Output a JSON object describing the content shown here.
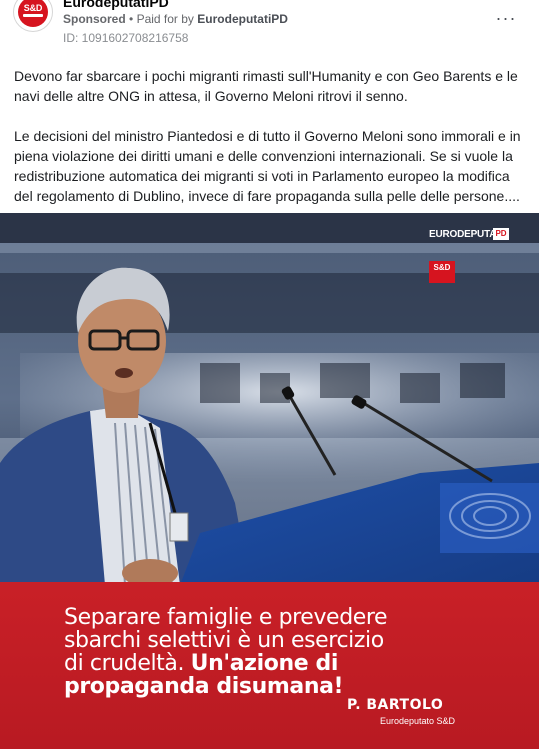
{
  "post": {
    "page_name": "EurodeputatiPD",
    "avatar_text": "S&D",
    "sponsored_label": "Sponsored",
    "separator": "•",
    "paid_for_prefix": "Paid for by",
    "paid_for_by": "EurodeputatiPD",
    "ad_id": "ID: 1091602708216758",
    "more_icon": "more-dots-icon",
    "more_label": "···",
    "paragraphs": [
      "Devono far sbarcare i pochi migranti rimasti sull'Humanity e con Geo Barents e le navi delle altre ONG in attesa, il Governo Meloni ritrovi il senno.",
      "Le decisioni del ministro Piantedosi e di tutto il Governo Meloni sono immorali e in piena violazione dei diritti umani e delle convenzioni internazionali. Se si vuole la redistribuzione automatica dei migranti si voti in Parlamento europeo la modifica del regolamento di Dublino, invece di fare propaganda sulla pelle delle persone...."
    ]
  },
  "creative": {
    "logo_euro": "EURODEPUTATI",
    "logo_pd": "PD",
    "logo_sd": "S&D",
    "banner_lines": [
      "Separare famiglie e prevedere",
      "sbarchi selettivi è un esercizio",
      "di crudeltà.",
      "Un'azione di",
      "propaganda disumana!"
    ],
    "signature_name": "P. BARTOLO",
    "signature_role": "Eurodeputato S&D",
    "colors": {
      "banner_red": "#c92027",
      "suit_blue": "#2e4a86",
      "hall_blue": "#3a4456"
    }
  }
}
